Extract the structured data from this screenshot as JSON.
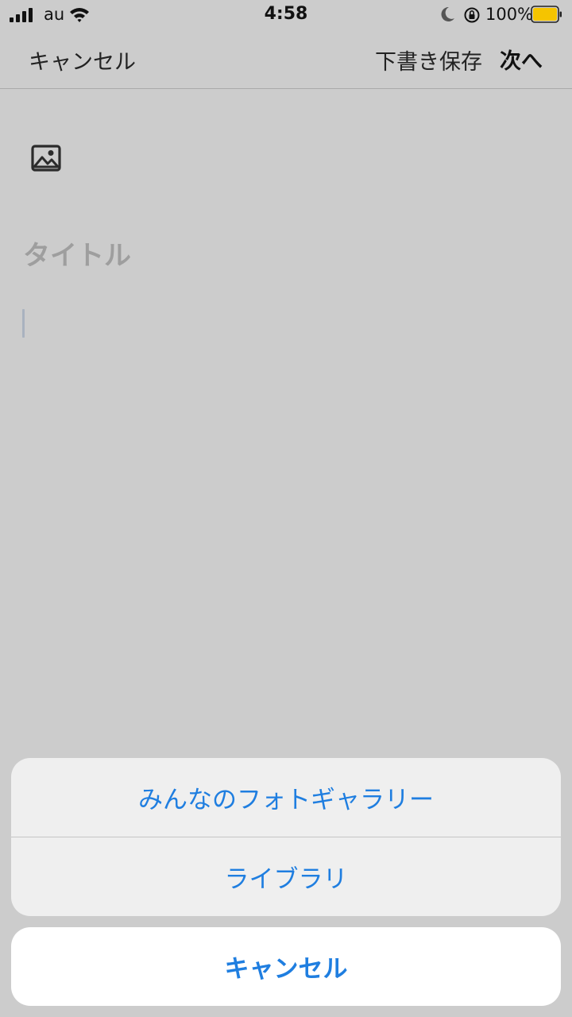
{
  "status_bar": {
    "carrier": "au",
    "time": "4:58",
    "battery_percent": "100%",
    "battery_level": 1.0,
    "battery_color": "#f5c400",
    "icons": [
      "signal-icon",
      "wifi-icon",
      "moon-icon",
      "rotation-lock-icon",
      "battery-icon"
    ]
  },
  "nav": {
    "cancel_label": "キャンセル",
    "draft_label": "下書き保存",
    "next_label": "次へ"
  },
  "editor": {
    "image_icon": "image-icon",
    "title_placeholder": "タイトル"
  },
  "action_sheet": {
    "options": [
      {
        "label": "みんなのフォトギャラリー"
      },
      {
        "label": "ライブラリ"
      }
    ],
    "cancel_label": "キャンセル",
    "accent_color": "#1f7ee0"
  }
}
